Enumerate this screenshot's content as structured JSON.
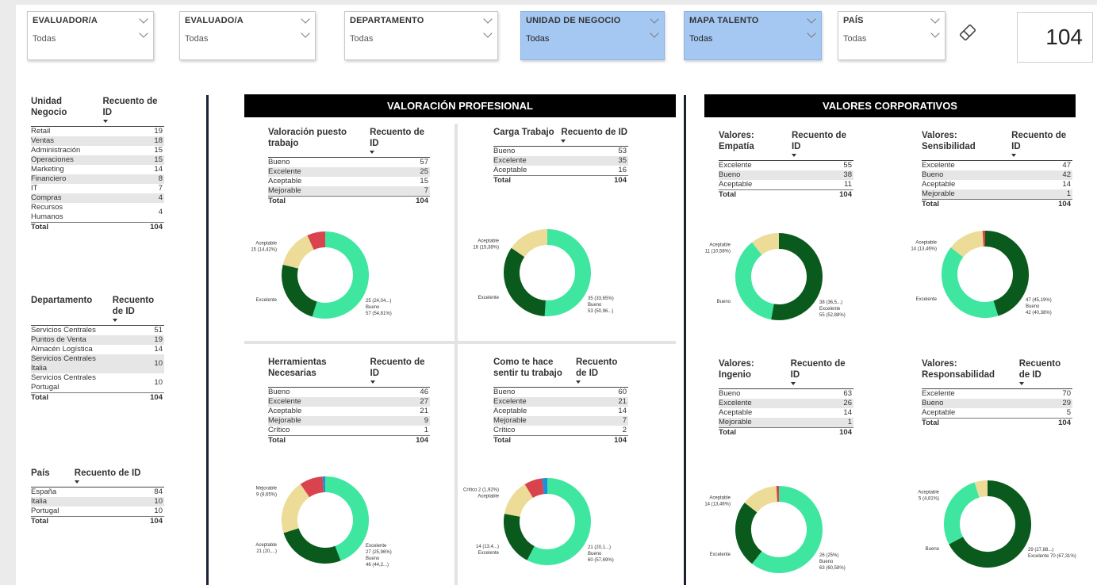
{
  "colors": {
    "excelente": "#0b5a1d",
    "bueno": "#3ee6a0",
    "aceptable": "#ecdc97",
    "mejorable": "#d9434e",
    "critico": "#1e8fe0",
    "active_slicer": "#a5c8f3"
  },
  "slicers": [
    {
      "title": "EVALUADOR/A",
      "value": "Todas",
      "active": false
    },
    {
      "title": "EVALUADO/A",
      "value": "Todas",
      "active": false
    },
    {
      "title": "DEPARTAMENTO",
      "value": "Todas",
      "active": false
    },
    {
      "title": "UNIDAD DE NEGOCIO",
      "value": "Todas",
      "active": true
    },
    {
      "title": "MAPA TALENTO",
      "value": "Todas",
      "active": true
    },
    {
      "title": "PAÍS",
      "value": "Todas",
      "active": false
    }
  ],
  "eraser_icon": "eraser-icon",
  "kpi": {
    "value": "104"
  },
  "left_tables": [
    {
      "c1": "Unidad Negocio",
      "c2": "Recuento de ID",
      "rows": [
        [
          "Retail",
          "19"
        ],
        [
          "Ventas",
          "18"
        ],
        [
          "Administración",
          "15"
        ],
        [
          "Operaciones",
          "15"
        ],
        [
          "Marketing",
          "14"
        ],
        [
          "Financiero",
          "8"
        ],
        [
          "IT",
          "7"
        ],
        [
          "Compras",
          "4"
        ],
        [
          "Recursos Humanos",
          "4"
        ]
      ],
      "total": [
        "Total",
        "104"
      ]
    },
    {
      "c1": "Departamento",
      "c2": "Recuento de ID",
      "rows": [
        [
          "Servicios Centrales",
          "51"
        ],
        [
          "Puntos de Venta",
          "19"
        ],
        [
          "Almacén Logística",
          "14"
        ],
        [
          "Servicios Centrales Italia",
          "10"
        ],
        [
          "Servicios Centrales Portugal",
          "10"
        ]
      ],
      "total": [
        "Total",
        "104"
      ]
    },
    {
      "c1": "País",
      "c2": "Recuento de ID",
      "rows": [
        [
          "España",
          "84"
        ],
        [
          "Italia",
          "10"
        ],
        [
          "Portugal",
          "10"
        ]
      ],
      "total": [
        "Total",
        "104"
      ]
    }
  ],
  "banners": {
    "left": "VALORACIÓN PROFESIONAL",
    "right": "VALORES CORPORATIVOS"
  },
  "matrices": [
    {
      "c1": "Valoración puesto trabajo",
      "c2": "Recuento de ID",
      "rows": [
        [
          "Bueno",
          "57"
        ],
        [
          "Excelente",
          "25"
        ],
        [
          "Aceptable",
          "15"
        ],
        [
          "Mejorable",
          "7"
        ]
      ],
      "total": [
        "Total",
        "104"
      ]
    },
    {
      "c1": "Carga Trabajo",
      "c2": "Recuento de ID",
      "rows": [
        [
          "Bueno",
          "53"
        ],
        [
          "Excelente",
          "35"
        ],
        [
          "Aceptable",
          "16"
        ]
      ],
      "total": [
        "Total",
        "104"
      ]
    },
    {
      "c1": "Herramientas Necesarias",
      "c2": "Recuento de ID",
      "rows": [
        [
          "Bueno",
          "46"
        ],
        [
          "Excelente",
          "27"
        ],
        [
          "Aceptable",
          "21"
        ],
        [
          "Mejorable",
          "9"
        ],
        [
          "Crítico",
          "1"
        ]
      ],
      "total": [
        "Total",
        "104"
      ]
    },
    {
      "c1": "Como te hace sentir tu trabajo",
      "c2": "Recuento de ID",
      "rows": [
        [
          "Bueno",
          "60"
        ],
        [
          "Excelente",
          "21"
        ],
        [
          "Aceptable",
          "14"
        ],
        [
          "Mejorable",
          "7"
        ],
        [
          "Crítico",
          "2"
        ]
      ],
      "total": [
        "Total",
        "104"
      ]
    },
    {
      "c1": "Valores: Empatía",
      "c2": "Recuento de ID",
      "rows": [
        [
          "Excelente",
          "55"
        ],
        [
          "Bueno",
          "38"
        ],
        [
          "Aceptable",
          "11"
        ]
      ],
      "total": [
        "Total",
        "104"
      ]
    },
    {
      "c1": "Valores: Sensibilidad",
      "c2": "Recuento de ID",
      "rows": [
        [
          "Excelente",
          "47"
        ],
        [
          "Bueno",
          "42"
        ],
        [
          "Aceptable",
          "14"
        ],
        [
          "Mejorable",
          "1"
        ]
      ],
      "total": [
        "Total",
        "104"
      ]
    },
    {
      "c1": "Valores: Ingenio",
      "c2": "Recuento de ID",
      "rows": [
        [
          "Bueno",
          "63"
        ],
        [
          "Excelente",
          "26"
        ],
        [
          "Aceptable",
          "14"
        ],
        [
          "Mejorable",
          "1"
        ]
      ],
      "total": [
        "Total",
        "104"
      ]
    },
    {
      "c1": "Valores: Responsabilidad",
      "c2": "Recuento de ID",
      "rows": [
        [
          "Excelente",
          "70"
        ],
        [
          "Bueno",
          "29"
        ],
        [
          "Aceptable",
          "5"
        ]
      ],
      "total": [
        "Total",
        "104"
      ]
    }
  ],
  "chart_data": [
    {
      "type": "pie",
      "title": "Valoración puesto trabajo",
      "slices": [
        {
          "name": "Bueno",
          "value": 57,
          "color": "bueno"
        },
        {
          "name": "Excelente",
          "value": 25,
          "color": "excelente"
        },
        {
          "name": "Aceptable",
          "value": 15,
          "color": "aceptable"
        },
        {
          "name": "Mejorable",
          "value": 7,
          "color": "mejorable"
        }
      ],
      "labels": [
        "Aceptable",
        "15 (14,42%)",
        "Excelente",
        "25 (24,04...)",
        "Bueno",
        "57 (54,81%)"
      ]
    },
    {
      "type": "pie",
      "title": "Carga Trabajo",
      "slices": [
        {
          "name": "Bueno",
          "value": 53,
          "color": "bueno"
        },
        {
          "name": "Excelente",
          "value": 35,
          "color": "excelente"
        },
        {
          "name": "Aceptable",
          "value": 16,
          "color": "aceptable"
        }
      ],
      "labels": [
        "Aceptable",
        "16 (15,38%)",
        "Excelente",
        "35 (33,65%)",
        "Bueno",
        "53 (50,96...)"
      ]
    },
    {
      "type": "pie",
      "title": "Herramientas Necesarias",
      "slices": [
        {
          "name": "Bueno",
          "value": 46,
          "color": "bueno"
        },
        {
          "name": "Excelente",
          "value": 27,
          "color": "excelente"
        },
        {
          "name": "Aceptable",
          "value": 21,
          "color": "aceptable"
        },
        {
          "name": "Mejorable",
          "value": 9,
          "color": "mejorable"
        },
        {
          "name": "Crítico",
          "value": 1,
          "color": "critico"
        }
      ],
      "labels": [
        "Mejorable",
        "9 (8,65%)",
        "Aceptable",
        "21 (20,...)",
        "Excelente",
        "27 (25,96%)",
        "Bueno",
        "46 (44,2...)"
      ]
    },
    {
      "type": "pie",
      "title": "Como te hace sentir tu trabajo",
      "slices": [
        {
          "name": "Bueno",
          "value": 60,
          "color": "bueno"
        },
        {
          "name": "Excelente",
          "value": 21,
          "color": "excelente"
        },
        {
          "name": "Aceptable",
          "value": 14,
          "color": "aceptable"
        },
        {
          "name": "Mejorable",
          "value": 7,
          "color": "mejorable"
        },
        {
          "name": "Crítico",
          "value": 2,
          "color": "critico"
        }
      ],
      "labels": [
        "Crítico 2 (1,92%)",
        "Aceptable",
        "14 (13,4...)",
        "Excelente",
        "21 (20,1...)",
        "Bueno",
        "60 (57,69%)"
      ]
    },
    {
      "type": "pie",
      "title": "Valores: Empatía",
      "slices": [
        {
          "name": "Excelente",
          "value": 55,
          "color": "excelente"
        },
        {
          "name": "Bueno",
          "value": 38,
          "color": "bueno"
        },
        {
          "name": "Aceptable",
          "value": 11,
          "color": "aceptable"
        }
      ],
      "labels": [
        "Aceptable",
        "11 (10,58%)",
        "Bueno",
        "38 (36,5...)",
        "Excelente",
        "55 (52,88%)"
      ]
    },
    {
      "type": "pie",
      "title": "Valores: Sensibilidad",
      "slices": [
        {
          "name": "Excelente",
          "value": 47,
          "color": "excelente"
        },
        {
          "name": "Bueno",
          "value": 42,
          "color": "bueno"
        },
        {
          "name": "Aceptable",
          "value": 14,
          "color": "aceptable"
        },
        {
          "name": "Mejorable",
          "value": 1,
          "color": "mejorable"
        }
      ],
      "labels": [
        "Aceptable",
        "14 (13,46%)",
        "Excelente",
        "47 (45,19%)",
        "Bueno",
        "42 (40,38%)"
      ]
    },
    {
      "type": "pie",
      "title": "Valores: Ingenio",
      "slices": [
        {
          "name": "Bueno",
          "value": 63,
          "color": "bueno"
        },
        {
          "name": "Excelente",
          "value": 26,
          "color": "excelente"
        },
        {
          "name": "Aceptable",
          "value": 14,
          "color": "aceptable"
        },
        {
          "name": "Mejorable",
          "value": 1,
          "color": "mejorable"
        }
      ],
      "labels": [
        "Aceptable",
        "14 (13,46%)",
        "Excelente",
        "26 (25%)",
        "Bueno",
        "63 (60,58%)"
      ]
    },
    {
      "type": "pie",
      "title": "Valores: Responsabilidad",
      "slices": [
        {
          "name": "Excelente",
          "value": 70,
          "color": "excelente"
        },
        {
          "name": "Bueno",
          "value": 29,
          "color": "bueno"
        },
        {
          "name": "Aceptable",
          "value": 5,
          "color": "aceptable"
        }
      ],
      "labels": [
        "Aceptable",
        "5 (4,81%)",
        "Bueno",
        "29 (27,88...)",
        "Excelente 70 (67,31%)"
      ]
    }
  ]
}
